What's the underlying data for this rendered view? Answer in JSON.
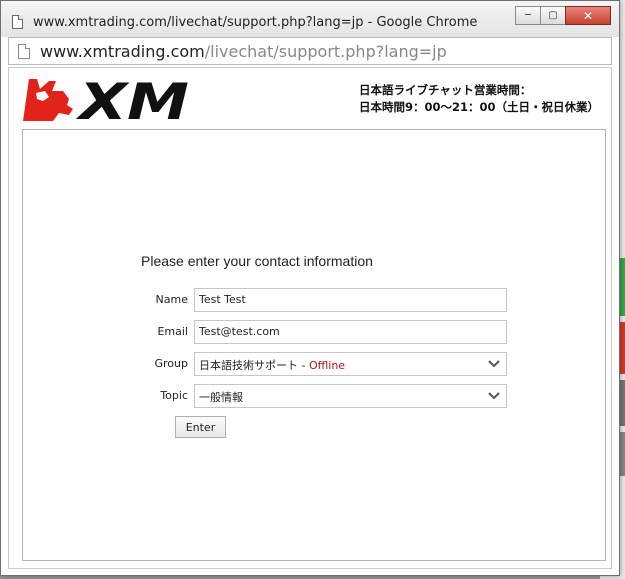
{
  "window": {
    "title": "www.xmtrading.com/livechat/support.php?lang=jp - Google Chrome",
    "buttons": {
      "minimize": "─",
      "maximize": "▢",
      "close": "✕"
    }
  },
  "address": {
    "host": "www.xmtrading.com",
    "path": "/livechat/support.php?lang=jp"
  },
  "header": {
    "logo_text": "XM",
    "hours_line1": "日本語ライブチャット営業時間：",
    "hours_line2": "日本時間9：00〜21：00（土日・祝日休業）"
  },
  "form": {
    "title": "Please enter your contact information",
    "name_label": "Name",
    "name_value": "Test Test",
    "email_label": "Email",
    "email_value": "Test@test.com",
    "group_label": "Group",
    "group_value": "日本語技術サポート - ",
    "group_status": "Offline",
    "topic_label": "Topic",
    "topic_value": "一般情報",
    "enter_label": "Enter"
  },
  "colors": {
    "logo_red": "#e2231a",
    "logo_black": "#111111",
    "offline": "#b01515",
    "close_button": "#c6412f"
  }
}
